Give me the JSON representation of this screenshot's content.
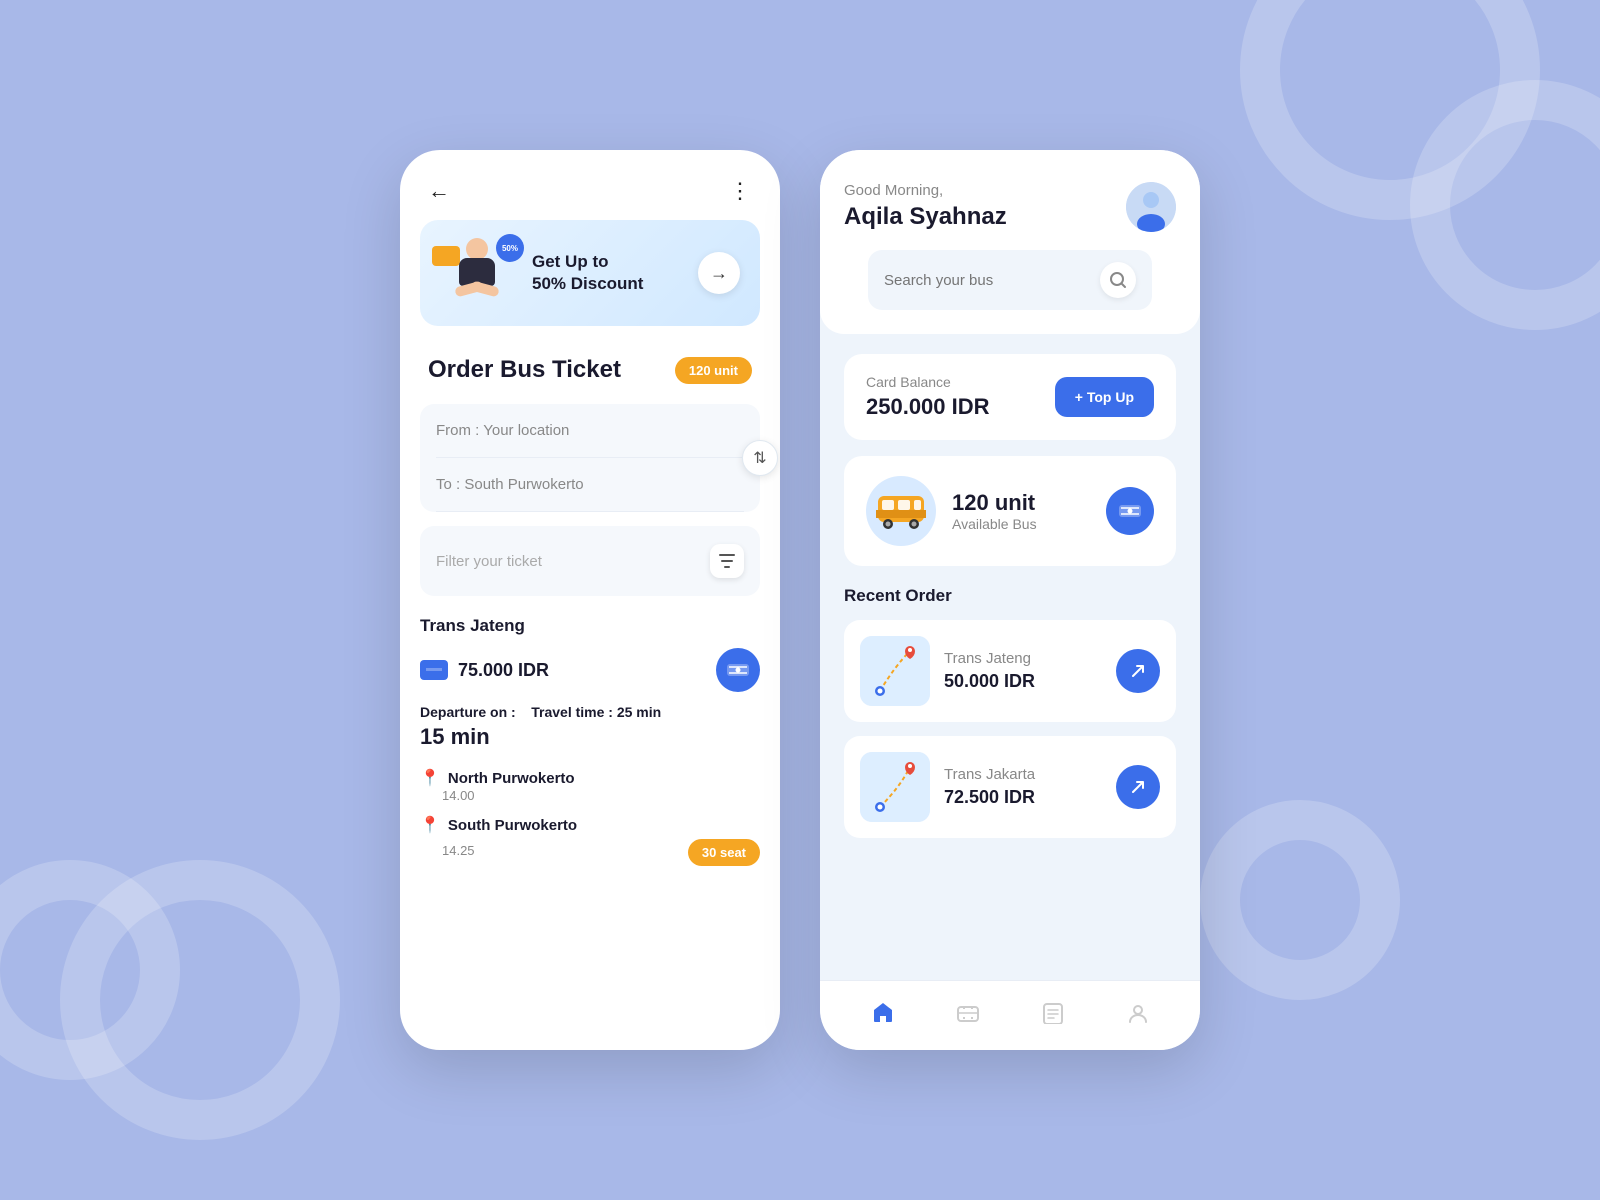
{
  "background_color": "#a8b8e8",
  "phone1": {
    "header": {
      "back_label": "←",
      "more_label": "⋮"
    },
    "banner": {
      "text_line1": "Get Up to",
      "text_line2": "50% Discount",
      "discount_badge": "50%",
      "arrow_label": "→"
    },
    "ticket_section": {
      "title": "Order Bus Ticket",
      "unit_badge": "120 unit"
    },
    "form": {
      "from_placeholder": "From : Your location",
      "to_placeholder": "To : South Purwokerto",
      "swap_icon": "⇅",
      "filter_placeholder": "Filter your ticket",
      "filter_icon": "▼"
    },
    "result": {
      "bus_name": "Trans Jateng",
      "price": "75.000 IDR",
      "departure_label": "Departure on :",
      "travel_time_label": "Travel time :",
      "travel_time_value": "25 min",
      "wait_time": "15 min",
      "stops": [
        {
          "name": "North Purwokerto",
          "time": "14.00",
          "dot_color": "blue"
        },
        {
          "name": "South Purwokerto",
          "time": "14.25",
          "dot_color": "red"
        }
      ],
      "seat_badge": "30 seat"
    }
  },
  "phone2": {
    "greeting_small": "Good Morning,",
    "greeting_name": "Aqila Syahnaz",
    "search_placeholder": "Search your bus",
    "balance": {
      "label": "Card Balance",
      "amount": "250.000 IDR",
      "topup_label": "+ Top Up"
    },
    "bus_availability": {
      "unit_count": "120 unit",
      "label": "Available Bus"
    },
    "recent_orders": {
      "title": "Recent Order",
      "items": [
        {
          "bus_name": "Trans Jateng",
          "price": "50.000 IDR"
        },
        {
          "bus_name": "Trans Jakarta",
          "price": "72.500 IDR"
        }
      ]
    },
    "bottom_nav": {
      "items": [
        "home",
        "tickets",
        "history",
        "profile"
      ]
    }
  }
}
